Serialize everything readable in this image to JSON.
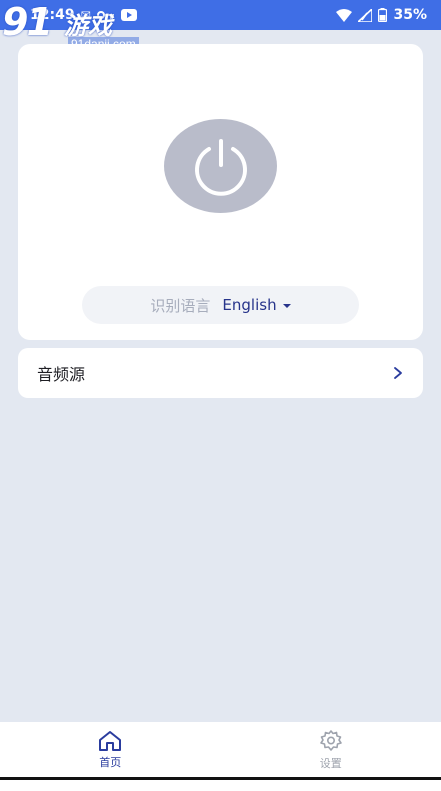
{
  "status_bar": {
    "time": "12:49",
    "battery": "35%",
    "icons": [
      "notification-icon",
      "key-icon",
      "youtube-icon",
      "wifi-icon",
      "signal-icon",
      "battery-icon"
    ]
  },
  "watermark": {
    "logo_number": "91",
    "logo_text": "游戏",
    "url": "91danji.com"
  },
  "main_card": {
    "power_button_icon": "power-icon",
    "language_label": "识别语言",
    "language_value": "English"
  },
  "audio_source": {
    "label": "音频源",
    "arrow_icon": "chevron-right-icon"
  },
  "bottom_nav": {
    "items": [
      {
        "label": "首页",
        "icon": "home-icon",
        "active": true
      },
      {
        "label": "设置",
        "icon": "gear-icon",
        "active": false
      }
    ]
  },
  "colors": {
    "status_bar": "#3f6ee6",
    "background": "#e3e8f1",
    "accent": "#2a3c9e",
    "power_button": "#b9bcca"
  }
}
